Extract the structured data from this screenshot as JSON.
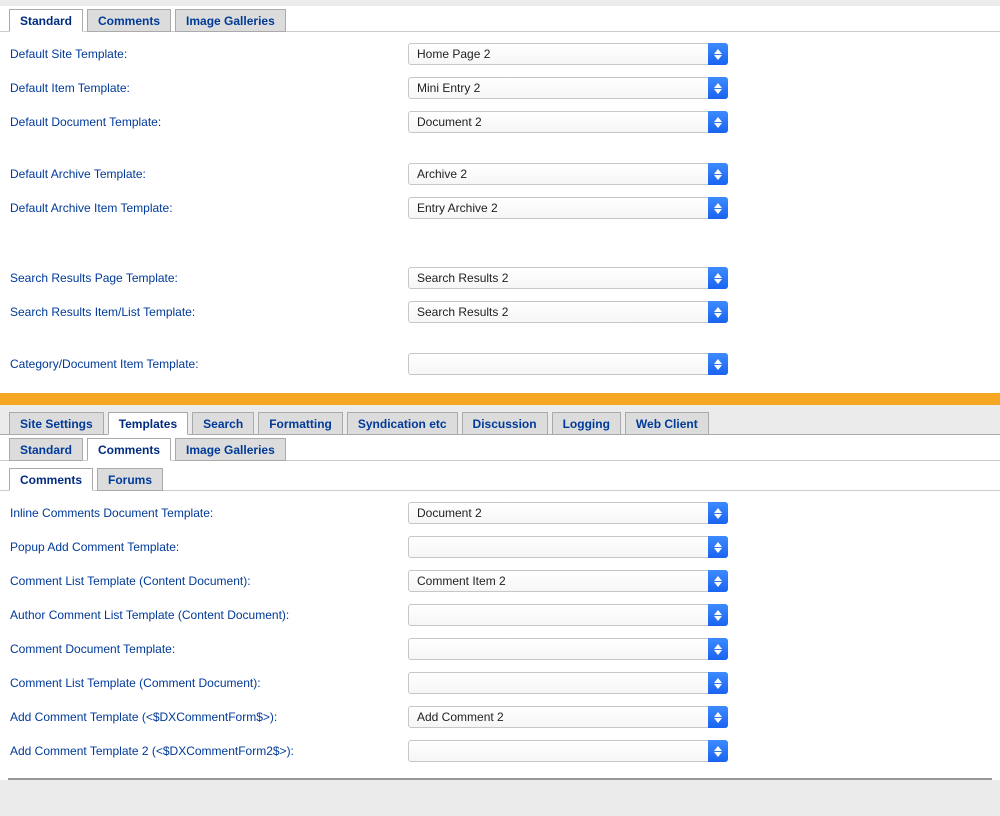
{
  "topTabs": {
    "standard": "Standard",
    "comments": "Comments",
    "galleries": "Image Galleries"
  },
  "standardForm": {
    "defaultSite": {
      "label": "Default Site Template:",
      "value": "Home Page 2"
    },
    "defaultItem": {
      "label": "Default Item Template:",
      "value": "Mini Entry 2"
    },
    "defaultDoc": {
      "label": "Default Document Template:",
      "value": "Document 2"
    },
    "defaultArchive": {
      "label": "Default Archive Template:",
      "value": "Archive 2"
    },
    "defaultArchiveItem": {
      "label": "Default Archive Item Template:",
      "value": "Entry Archive 2"
    },
    "searchPage": {
      "label": "Search Results Page Template:",
      "value": "Search Results 2"
    },
    "searchItem": {
      "label": "Search Results Item/List Template:",
      "value": "Search Results 2"
    },
    "catDocItem": {
      "label": "Category/Document Item Template:",
      "value": ""
    }
  },
  "mainTabs": {
    "siteSettings": "Site Settings",
    "templates": "Templates",
    "search": "Search",
    "formatting": "Formatting",
    "syndication": "Syndication etc",
    "discussion": "Discussion",
    "logging": "Logging",
    "webClient": "Web Client"
  },
  "subTabs": {
    "standard": "Standard",
    "comments": "Comments",
    "galleries": "Image Galleries"
  },
  "subSubTabs": {
    "comments": "Comments",
    "forums": "Forums"
  },
  "commentsForm": {
    "inlineDoc": {
      "label": "Inline Comments Document Template:",
      "value": "Document 2"
    },
    "popupAdd": {
      "label": "Popup Add Comment Template:",
      "value": ""
    },
    "listContent": {
      "label": "Comment List Template (Content Document):",
      "value": "Comment Item 2"
    },
    "authorList": {
      "label": "Author Comment List Template (Content Document):",
      "value": ""
    },
    "commentDoc": {
      "label": "Comment Document Template:",
      "value": ""
    },
    "listCommentDoc": {
      "label": "Comment List Template (Comment Document):",
      "value": ""
    },
    "addComment": {
      "label": "Add Comment Template (<$DXCommentForm$>):",
      "value": "Add Comment 2"
    },
    "addComment2": {
      "label": "Add Comment Template 2 (<$DXCommentForm2$>):",
      "value": ""
    }
  }
}
